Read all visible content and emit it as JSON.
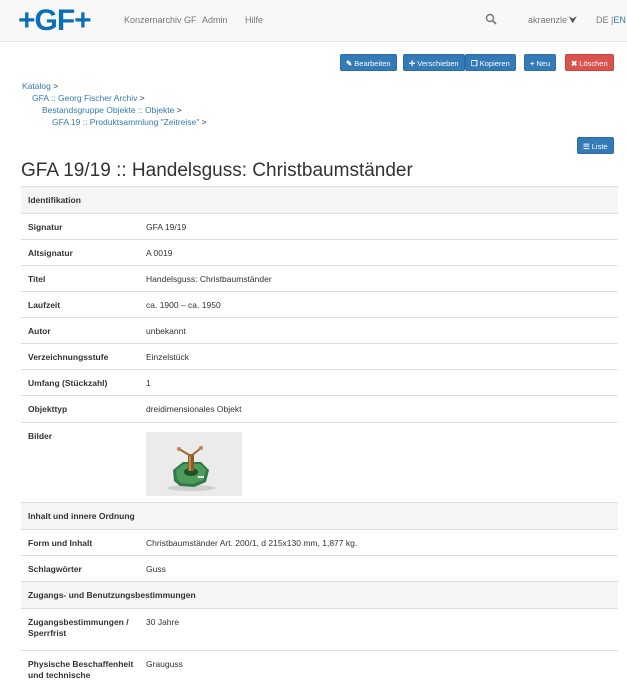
{
  "navbar": {
    "logo": "+GF+",
    "links": [
      "Konzernarchiv GF",
      "Admin",
      "Hilfe"
    ],
    "user": "akraenzle",
    "lang_de": "DE",
    "lang_sep": "|",
    "lang_en": "EN",
    "search_icon": "search-icon"
  },
  "actions": {
    "edit": "Bearbeiten",
    "move": "Verschieben",
    "copy": "Kopieren",
    "new": "Neu",
    "delete": "Löschen",
    "list": "Liste"
  },
  "breadcrumb": {
    "items": [
      "Katalog",
      "GFA :: Georg Fischer Archiv",
      "Bestandsgruppe Objekte :: Objekte",
      "GFA 19 :: Produktsammlung \"Zeitreise\""
    ],
    "separator": ">"
  },
  "page_title": "GFA 19/19 :: Handelsguss: Christbaumständer",
  "sections": {
    "identifikation": "Identifikation",
    "inhalt": "Inhalt und innere Ordnung",
    "zugang": "Zugangs- und Benutzungsbestimmungen"
  },
  "fields": {
    "signatur": {
      "label": "Signatur",
      "value": "GFA 19/19"
    },
    "altsignatur": {
      "label": "Altsignatur",
      "value": "A 0019"
    },
    "titel": {
      "label": "Titel",
      "value": "Handelsguss: Christbaumständer"
    },
    "laufzeit": {
      "label": "Laufzeit",
      "value": "ca. 1900 – ca. 1950"
    },
    "autor": {
      "label": "Autor",
      "value": "unbekannt"
    },
    "verzeichnungsstufe": {
      "label": "Verzeichnungsstufe",
      "value": "Einzelstück"
    },
    "umfang": {
      "label": "Umfang (Stückzahl)",
      "value": "1"
    },
    "objekttyp": {
      "label": "Objekttyp",
      "value": "dreidimensionales Objekt"
    },
    "bilder": {
      "label": "Bilder"
    },
    "form": {
      "label": "Form und Inhalt",
      "value": "Christbaumständer Art. 200/1, d 215x130 mm, 1,877 kg."
    },
    "schlagwoerter": {
      "label": "Schlagwörter",
      "value": "Guss"
    },
    "zugangsbest": {
      "label_line1": "Zugangsbestimmungen /",
      "label_line2": "Sperrfrist",
      "value": "30 Jahre"
    },
    "physisch": {
      "label_line1": "Physische Beschaffenheit",
      "label_line2": "und technische",
      "value": "Grauguss"
    }
  },
  "colors": {
    "brand": "#0b6fb8",
    "primary": "#337ab7",
    "danger": "#d9534f"
  }
}
